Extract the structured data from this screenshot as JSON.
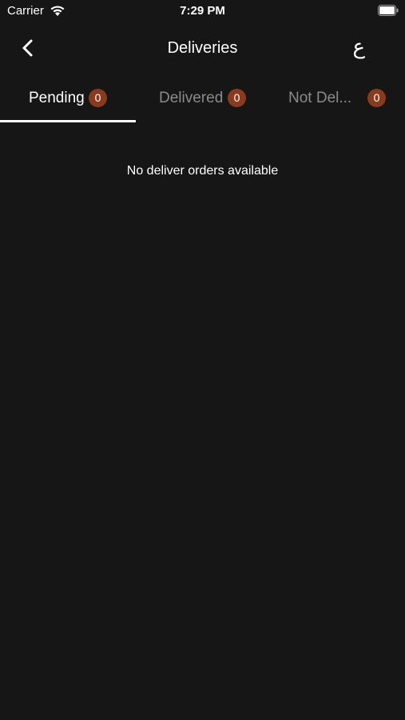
{
  "status_bar": {
    "carrier": "Carrier",
    "time": "7:29 PM",
    "wifi_icon": "wifi-icon",
    "battery_icon": "battery-icon"
  },
  "nav": {
    "title": "Deliveries",
    "back_icon": "chevron-left-icon",
    "language_toggle": "ع"
  },
  "tabs": [
    {
      "label": "Pending",
      "count": "0",
      "active": true
    },
    {
      "label": "Delivered",
      "count": "0",
      "active": false
    },
    {
      "label": "Not Del...",
      "count": "0",
      "active": false
    }
  ],
  "content": {
    "empty_message": "No deliver orders available"
  },
  "colors": {
    "background": "#161616",
    "badge": "#8b3a1c",
    "active_tab": "#ffffff",
    "inactive_tab": "#8a8a8a"
  }
}
